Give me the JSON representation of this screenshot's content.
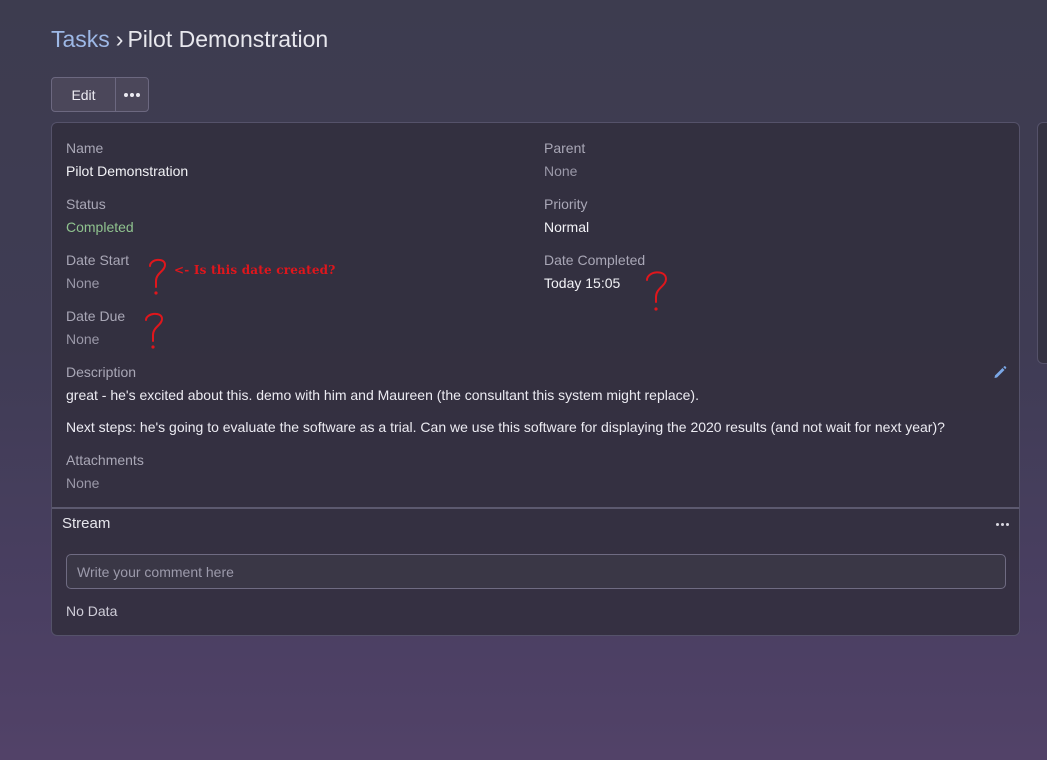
{
  "breadcrumb": {
    "parent": "Tasks",
    "separator": "›",
    "current": "Pilot Demonstration"
  },
  "toolbar": {
    "edit_label": "Edit",
    "more_icon": "ellipsis-icon"
  },
  "fields": {
    "name": {
      "label": "Name",
      "value": "Pilot Demonstration"
    },
    "parent": {
      "label": "Parent",
      "value": "None"
    },
    "status": {
      "label": "Status",
      "value": "Completed"
    },
    "priority": {
      "label": "Priority",
      "value": "Normal"
    },
    "date_start": {
      "label": "Date Start",
      "value": "None"
    },
    "date_completed": {
      "label": "Date Completed",
      "value": "Today 15:05"
    },
    "date_due": {
      "label": "Date Due",
      "value": "None"
    },
    "description": {
      "label": "Description",
      "paragraphs": [
        "great - he's excited about this. demo with him and Maureen (the consultant this system might replace).",
        "Next steps: he's going to evaluate the software as a trial. Can we use this software for displaying the 2020 results (and not wait for next year)?"
      ],
      "edit_icon": "pencil-icon"
    },
    "attachments": {
      "label": "Attachments",
      "value": "None"
    }
  },
  "stream": {
    "title": "Stream",
    "menu_icon": "ellipsis-icon",
    "comment_placeholder": "Write your comment here",
    "empty_text": "No Data"
  },
  "annotations": {
    "question_mark": "?",
    "note": "<- Is this date created?",
    "color": "#e0161c"
  },
  "colors": {
    "link": "#9db8e6",
    "status_completed": "#8fc28e",
    "edit_icon": "#7aa7e6"
  }
}
